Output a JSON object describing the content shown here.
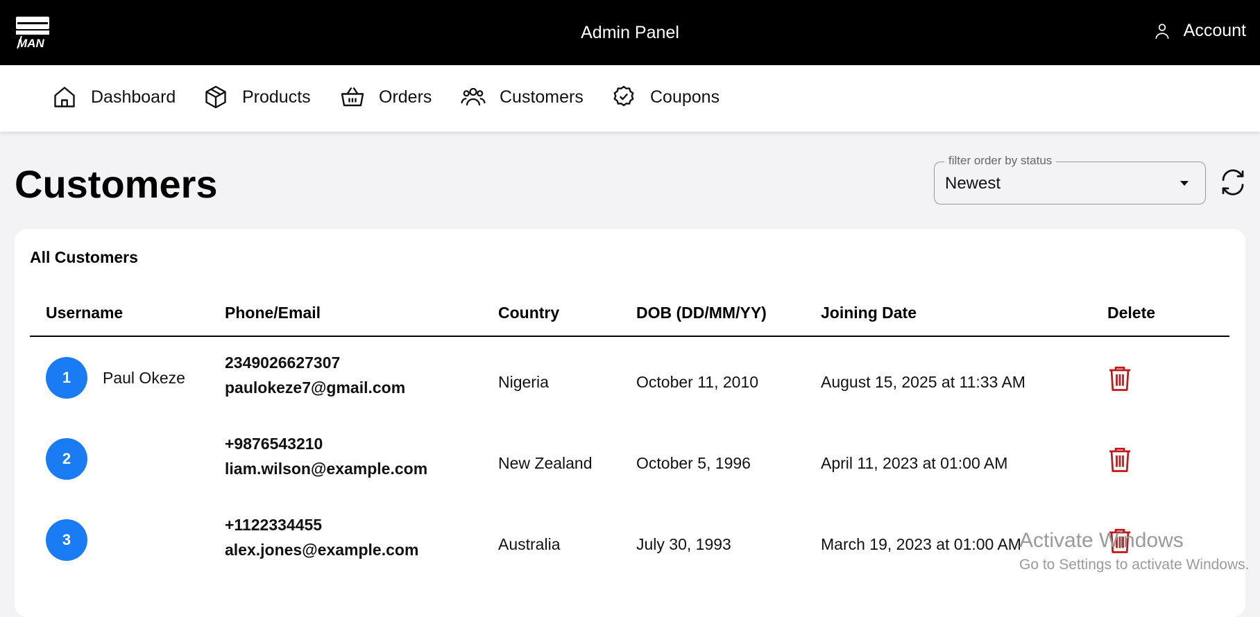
{
  "header": {
    "logo_text": "MAN",
    "title": "Admin Panel",
    "account_label": "Account"
  },
  "nav": [
    {
      "label": "Dashboard"
    },
    {
      "label": "Products"
    },
    {
      "label": "Orders"
    },
    {
      "label": "Customers"
    },
    {
      "label": "Coupons"
    }
  ],
  "page": {
    "title": "Customers",
    "filter": {
      "legend": "filter order by status",
      "value": "Newest"
    }
  },
  "card": {
    "title": "All Customers",
    "columns": [
      "Username",
      "Phone/Email",
      "Country",
      "DOB (DD/MM/YY)",
      "Joining Date",
      "Delete"
    ],
    "rows": [
      {
        "index": "1",
        "username": "Paul Okeze",
        "phone": "2349026627307",
        "email": "paulokeze7@gmail.com",
        "country": "Nigeria",
        "dob": "October 11, 2010",
        "joined": "August 15, 2025 at 11:33 AM"
      },
      {
        "index": "2",
        "username": "",
        "phone": "+9876543210",
        "email": "liam.wilson@example.com",
        "country": "New Zealand",
        "dob": "October 5, 1996",
        "joined": "April 11, 2023 at 01:00 AM"
      },
      {
        "index": "3",
        "username": "",
        "phone": "+1122334455",
        "email": "alex.jones@example.com",
        "country": "Australia",
        "dob": "July 30, 1993",
        "joined": "March 19, 2023 at 01:00 AM"
      }
    ]
  },
  "watermark": {
    "title": "Activate Windows",
    "subtitle": "Go to Settings to activate Windows."
  },
  "colors": {
    "topbar": "#000000",
    "avatar": "#1a7cf5",
    "delete": "#c01818",
    "background": "#f3f2f5"
  }
}
